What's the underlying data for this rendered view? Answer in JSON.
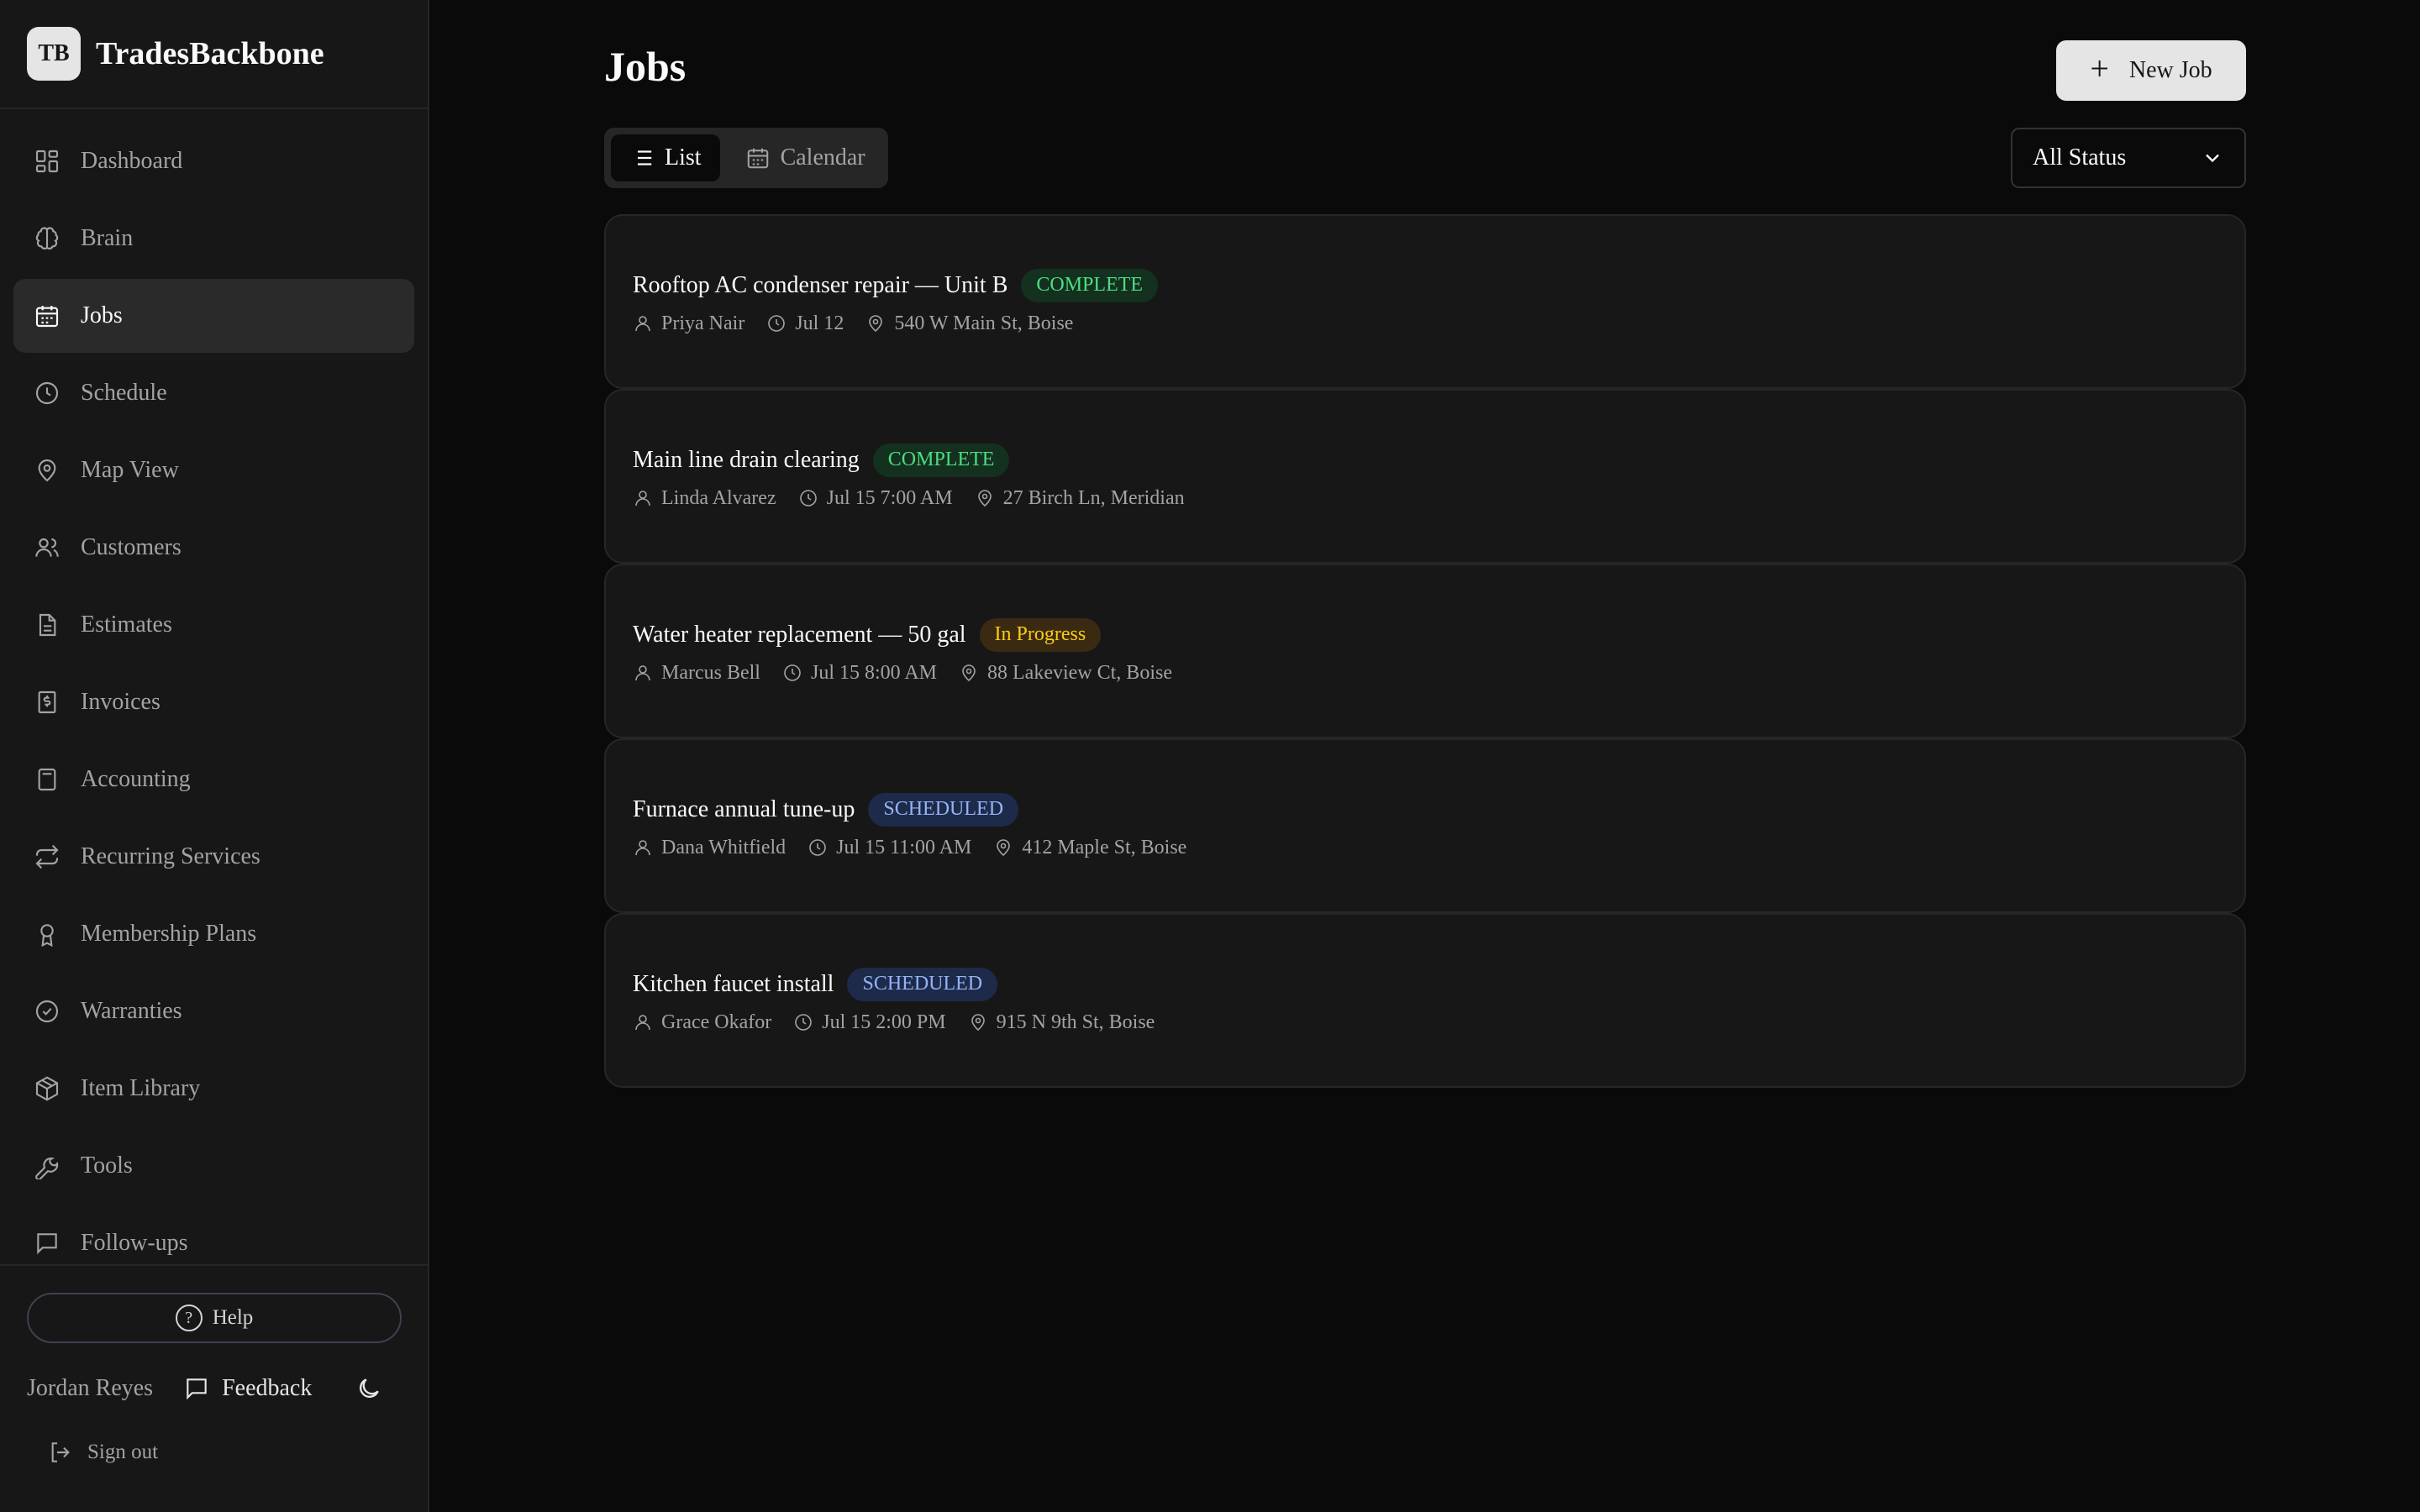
{
  "brand": {
    "logo": "TB",
    "name": "TradesBackbone"
  },
  "nav": [
    {
      "label": "Dashboard",
      "icon": "dashboard-icon"
    },
    {
      "label": "Brain",
      "icon": "brain-icon"
    },
    {
      "label": "Jobs",
      "icon": "calendar-icon",
      "active": true
    },
    {
      "label": "Schedule",
      "icon": "clock-icon"
    },
    {
      "label": "Map View",
      "icon": "map-pin-icon"
    },
    {
      "label": "Customers",
      "icon": "users-icon"
    },
    {
      "label": "Estimates",
      "icon": "file-text-icon"
    },
    {
      "label": "Invoices",
      "icon": "receipt-icon"
    },
    {
      "label": "Accounting",
      "icon": "calculator-icon"
    },
    {
      "label": "Recurring Services",
      "icon": "repeat-icon"
    },
    {
      "label": "Membership Plans",
      "icon": "award-icon"
    },
    {
      "label": "Warranties",
      "icon": "badge-check-icon"
    },
    {
      "label": "Item Library",
      "icon": "package-icon"
    },
    {
      "label": "Tools",
      "icon": "wrench-icon"
    },
    {
      "label": "Follow-ups",
      "icon": "message-square-icon"
    }
  ],
  "footer": {
    "help_label": "Help",
    "user_name": "Jordan Reyes",
    "feedback_label": "Feedback",
    "signout_label": "Sign out"
  },
  "page": {
    "title": "Jobs",
    "new_job_label": "New Job",
    "views": {
      "list": "List",
      "calendar": "Calendar"
    },
    "status_filter": "All Status"
  },
  "jobs": [
    {
      "title": "Rooftop AC condenser repair — Unit B",
      "status": "COMPLETE",
      "status_kind": "complete",
      "tech": "Priya Nair",
      "time": "Jul 12",
      "address": "540 W Main St, Boise"
    },
    {
      "title": "Main line drain clearing",
      "status": "COMPLETE",
      "status_kind": "complete",
      "tech": "Linda Alvarez",
      "time": "Jul 15 7:00 AM",
      "address": "27 Birch Ln, Meridian"
    },
    {
      "title": "Water heater replacement — 50 gal",
      "status": "In Progress",
      "status_kind": "progress",
      "tech": "Marcus Bell",
      "time": "Jul 15 8:00 AM",
      "address": "88 Lakeview Ct, Boise"
    },
    {
      "title": "Furnace annual tune-up",
      "status": "SCHEDULED",
      "status_kind": "scheduled",
      "tech": "Dana Whitfield",
      "time": "Jul 15 11:00 AM",
      "address": "412 Maple St, Boise"
    },
    {
      "title": "Kitchen faucet install",
      "status": "SCHEDULED",
      "status_kind": "scheduled",
      "tech": "Grace Okafor",
      "time": "Jul 15 2:00 PM",
      "address": "915 N 9th St, Boise"
    }
  ]
}
